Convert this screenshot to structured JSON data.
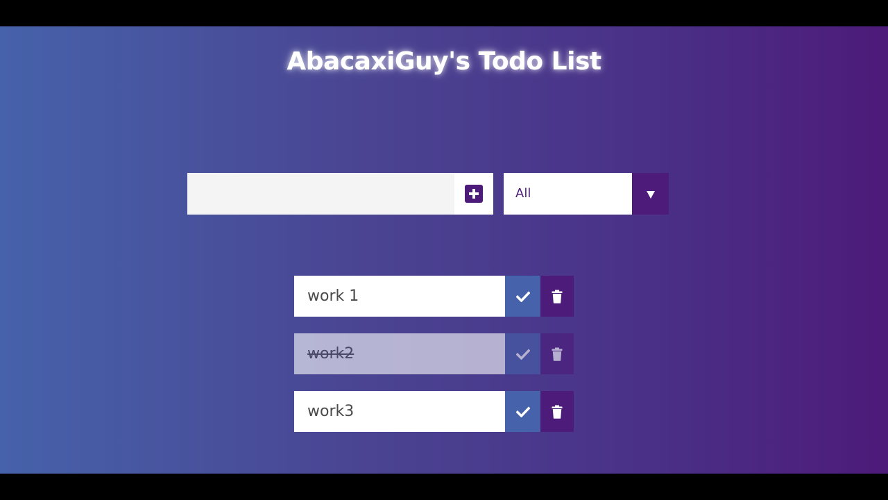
{
  "header": {
    "title": "AbacaxiGuy's Todo List"
  },
  "form": {
    "input_value": "",
    "input_placeholder": "",
    "add_icon": "plus-square-icon",
    "filter": {
      "selected": "All",
      "arrow_icon": "caret-down-icon"
    }
  },
  "todos": [
    {
      "text": "work 1",
      "completed": false
    },
    {
      "text": "work2",
      "completed": true
    },
    {
      "text": "work3",
      "completed": false
    }
  ],
  "icons": {
    "complete": "check-icon",
    "delete": "trash-icon"
  },
  "colors": {
    "gradient_start": "#4662aa",
    "gradient_end": "#4d1b79",
    "accent_purple": "#4d1b79",
    "accent_blue": "#4662aa"
  }
}
